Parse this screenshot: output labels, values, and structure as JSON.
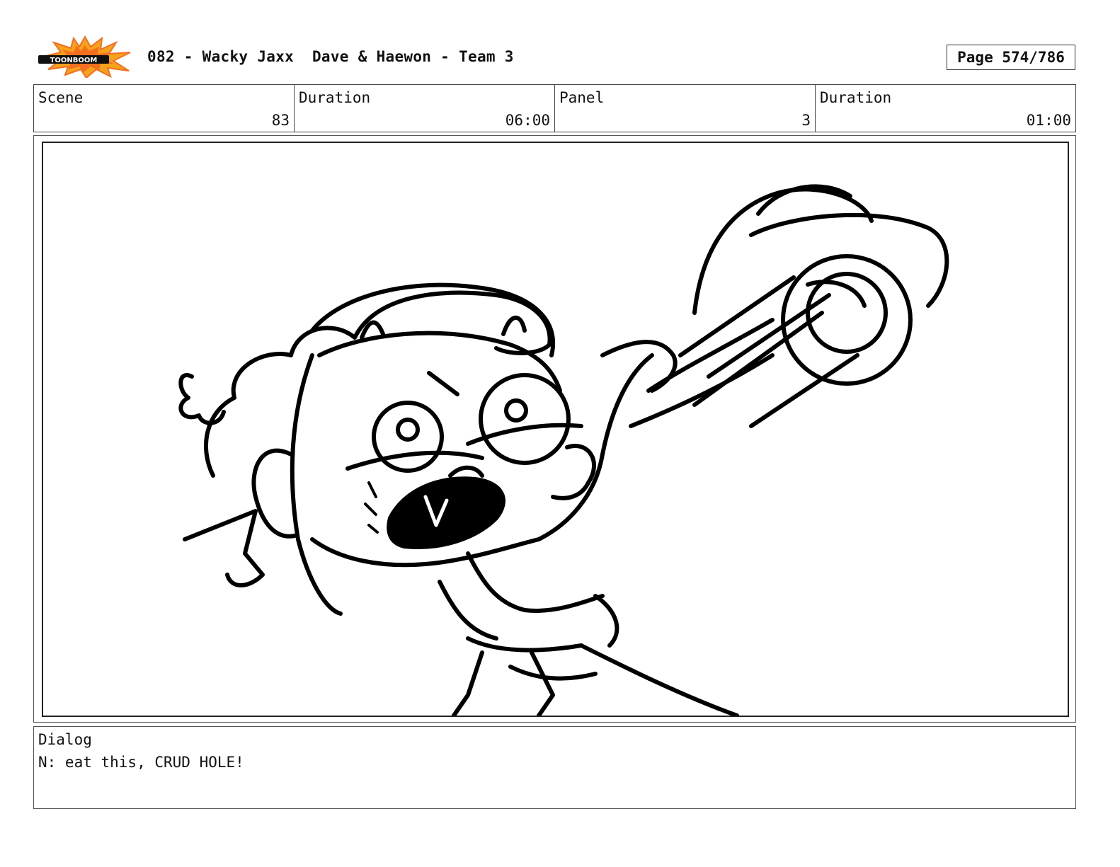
{
  "header": {
    "logo_text": "TOONBOOM",
    "title": "082 - Wacky Jaxx  Dave & Haewon - Team 3",
    "page_label": "Page 574/786"
  },
  "info": {
    "scene_label": "Scene",
    "scene_value": "83",
    "scene_duration_label": "Duration",
    "scene_duration_value": "06:00",
    "panel_label": "Panel",
    "panel_value": "3",
    "panel_duration_label": "Duration",
    "panel_duration_value": "01:00"
  },
  "dialog": {
    "label": "Dialog",
    "text": "N: eat this, CRUD HOLE!"
  },
  "colors": {
    "logo_burst_outer": "#f7a21b",
    "logo_burst_inner": "#f26f21",
    "logo_bar": "#111111"
  }
}
